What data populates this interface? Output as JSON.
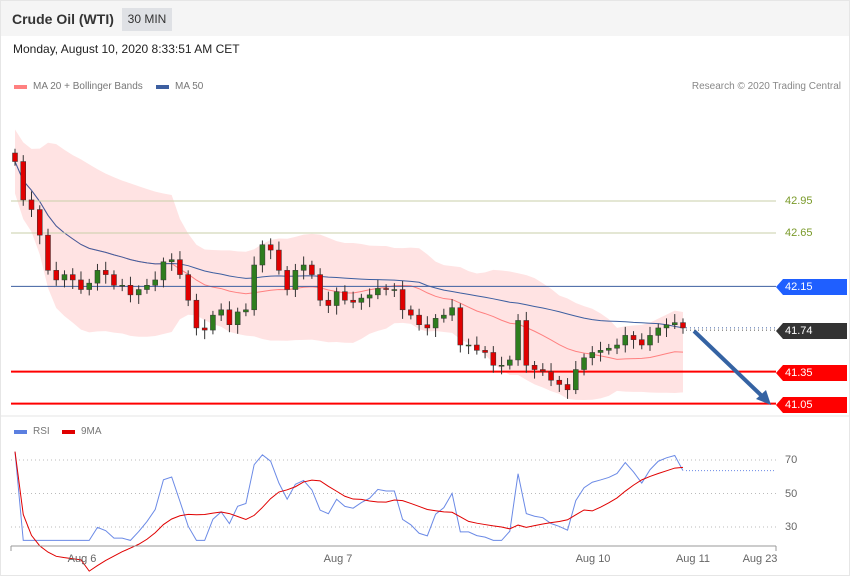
{
  "header": {
    "title": "Crude Oil (WTI)",
    "timeframe": "30 MIN",
    "datetime": "Monday, August 10, 2020 8:33:51 AM CET"
  },
  "legend": {
    "ma20": "MA 20 + Bollinger Bands",
    "ma50": "MA 50",
    "rsi": "RSI",
    "ma9": "9MA",
    "credit": "Research © 2020 Trading Central"
  },
  "colors": {
    "up": "#2e7d1e",
    "down": "#e00000",
    "ma20": "#ff8080",
    "ma50": "#3d5fa0",
    "band": "#ffe3e3",
    "resistance": "#1f5fff",
    "support": "#ff0000",
    "last": "#333333"
  },
  "levels": {
    "r2": "42.95",
    "r1": "42.65",
    "pivot": "42.15",
    "last": "41.74",
    "s1": "41.35",
    "s2": "41.05"
  },
  "rsi_axis": [
    "70",
    "50",
    "30"
  ],
  "x_axis": [
    "Aug 6",
    "Aug 7",
    "Aug 10",
    "Aug 11",
    "Aug 23"
  ],
  "chart_data": {
    "type": "candlestick",
    "closes": [
      43.32,
      42.96,
      42.87,
      42.63,
      42.3,
      42.21,
      42.26,
      42.21,
      42.12,
      42.18,
      42.3,
      42.26,
      42.16,
      42.16,
      42.07,
      42.12,
      42.16,
      42.21,
      42.38,
      42.4,
      42.26,
      42.02,
      41.76,
      41.74,
      41.88,
      41.93,
      41.79,
      41.91,
      41.93,
      42.35,
      42.54,
      42.49,
      42.3,
      42.12,
      42.3,
      42.35,
      42.26,
      42.02,
      41.97,
      42.1,
      42.02,
      42.0,
      42.04,
      42.07,
      42.13,
      42.12,
      42.12,
      41.93,
      41.88,
      41.79,
      41.76,
      41.85,
      41.88,
      41.95,
      41.6,
      41.6,
      41.55,
      41.53,
      41.41,
      41.41,
      41.46,
      41.83,
      41.41,
      41.37,
      41.35,
      41.27,
      41.23,
      41.18,
      41.37,
      41.48,
      41.53,
      41.55,
      41.57,
      41.6,
      41.69,
      41.65,
      41.6,
      41.69,
      41.76,
      41.79,
      41.81,
      41.76
    ],
    "first_open": 43.4
  }
}
